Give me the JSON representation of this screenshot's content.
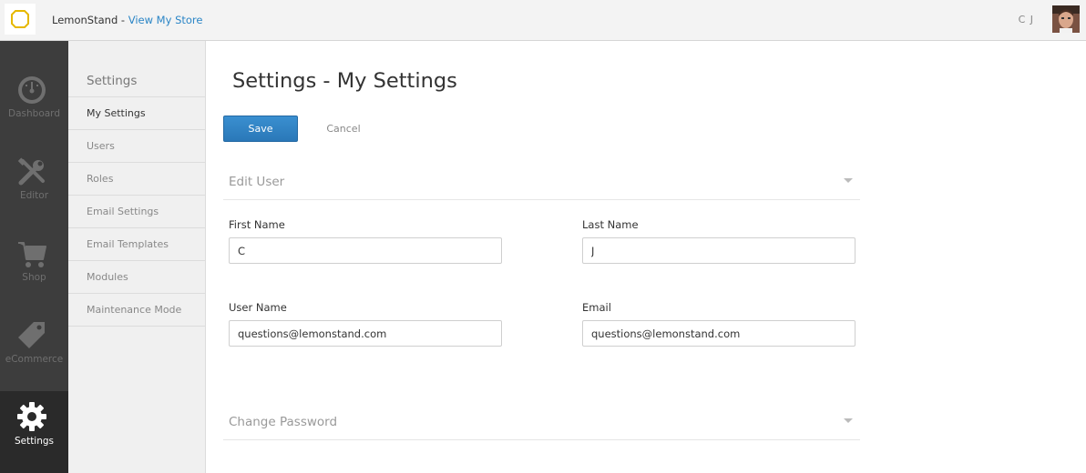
{
  "topbar": {
    "brand_name": "LemonStand",
    "brand_separator": " - ",
    "view_store_link": "View My Store",
    "user_initials": "C J",
    "logo_icon": "lemonstand-logo-icon",
    "accent_color": "#2a85c6"
  },
  "leftnav": {
    "items": [
      {
        "label": "Dashboard",
        "icon": "dashboard-gauge-icon"
      },
      {
        "label": "Editor",
        "icon": "tools-icon"
      },
      {
        "label": "Shop",
        "icon": "cart-icon"
      },
      {
        "label": "eCommerce",
        "icon": "tag-icon"
      },
      {
        "label": "Settings",
        "icon": "gear-icon"
      }
    ],
    "active": "Settings"
  },
  "subnav": {
    "title": "Settings",
    "items": [
      {
        "label": "My Settings"
      },
      {
        "label": "Users"
      },
      {
        "label": "Roles"
      },
      {
        "label": "Email Settings"
      },
      {
        "label": "Email Templates"
      },
      {
        "label": "Modules"
      },
      {
        "label": "Maintenance Mode"
      }
    ],
    "active": "My Settings"
  },
  "main": {
    "title": "Settings - My Settings",
    "save_label": "Save",
    "cancel_label": "Cancel",
    "edit_user": {
      "title": "Edit User",
      "first_name_label": "First Name",
      "first_name_value": "C",
      "last_name_label": "Last Name",
      "last_name_value": "J",
      "username_label": "User Name",
      "username_value": "questions@lemonstand.com",
      "email_label": "Email",
      "email_value": "questions@lemonstand.com"
    },
    "change_password": {
      "title": "Change Password"
    }
  }
}
